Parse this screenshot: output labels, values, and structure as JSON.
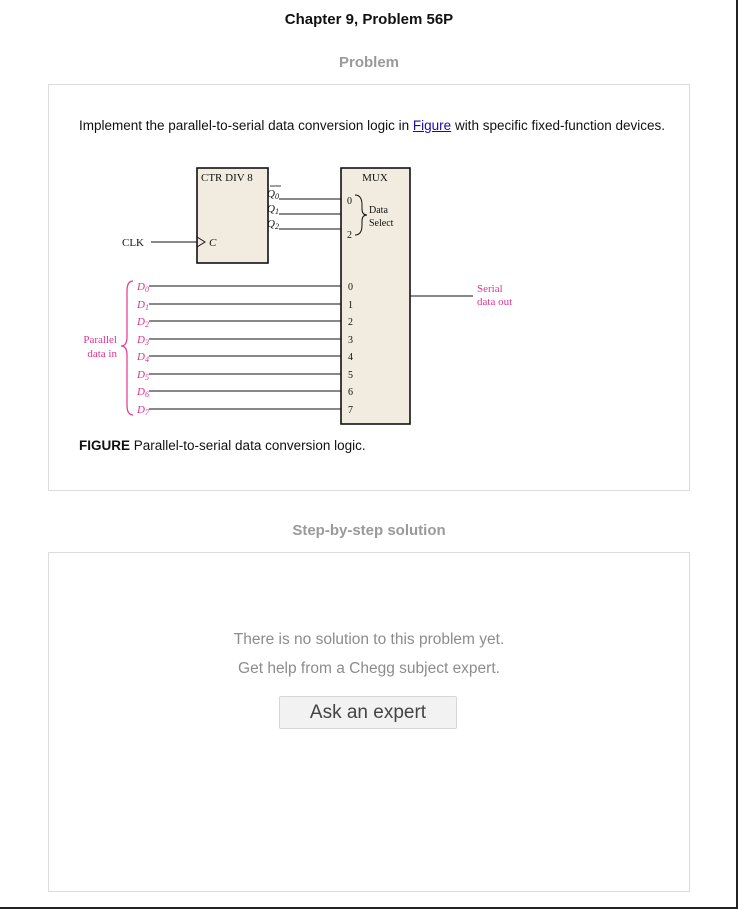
{
  "chapter_title": "Chapter 9, Problem 56P",
  "problem_heading": "Problem",
  "problem": {
    "text_before_link": "Implement the parallel-to-serial data conversion logic in ",
    "link_text": "Figure",
    "text_after_link": " with specific fixed-function devices."
  },
  "figure": {
    "counter_label": "CTR DIV 8",
    "counter_outputs": [
      "Q0",
      "Q1",
      "Q2"
    ],
    "clock_input": "C",
    "clk_label": "CLK",
    "mux_label": "MUX",
    "select_top": "0",
    "select_bottom": "2",
    "data_select_line1": "Data",
    "data_select_line2": "Select",
    "mux_inputs": [
      "0",
      "1",
      "2",
      "3",
      "4",
      "5",
      "6",
      "7"
    ],
    "data_inputs": [
      "D0",
      "D1",
      "D2",
      "D3",
      "D4",
      "D5",
      "D6",
      "D7"
    ],
    "parallel_line1": "Parallel",
    "parallel_line2": "data in",
    "serial_line1": "Serial",
    "serial_line2": "data out",
    "accent_color": "#e2358d",
    "box_fill": "#f1ebe0"
  },
  "caption": {
    "label": "FIGURE",
    "text": " Parallel-to-serial data conversion logic."
  },
  "solution_heading": "Step-by-step solution",
  "solution": {
    "no_solution": "There is no solution to this problem yet.",
    "get_help": "Get help from a Chegg subject expert.",
    "ask_button": "Ask an expert"
  }
}
